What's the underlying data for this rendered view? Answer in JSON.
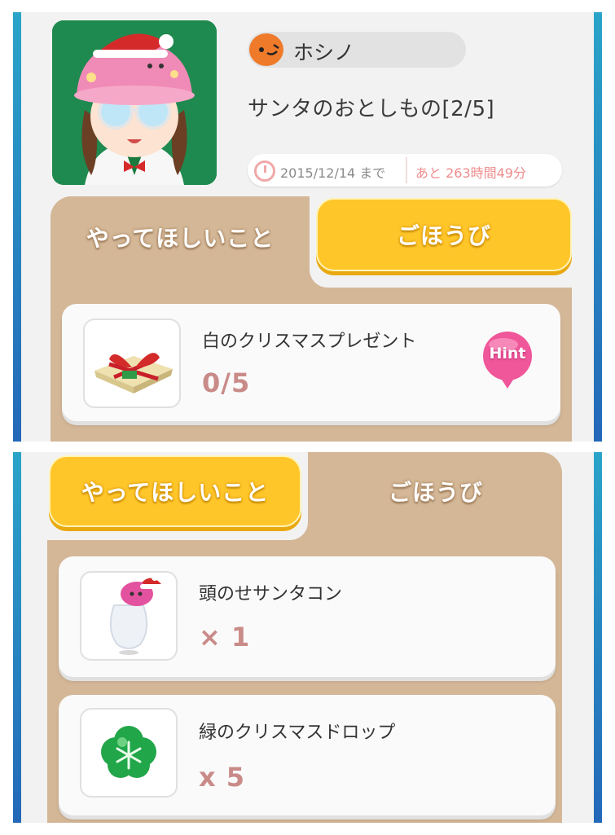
{
  "top": {
    "user_name": "ホシノ",
    "quest_title": "サンタのおとしもの[2/5]",
    "deadline_date": "2015/12/14 まで",
    "deadline_remaining": "あと 263時間49分",
    "tabs": [
      {
        "label": "やってほしいこと",
        "active": true
      },
      {
        "label": "ごほうび",
        "active": false
      }
    ],
    "task": {
      "name": "白のクリスマスプレゼント",
      "progress": "0/5",
      "hint_label": "Hint"
    }
  },
  "bottom": {
    "tabs": [
      {
        "label": "やってほしいこと",
        "active": false
      },
      {
        "label": "ごほうび",
        "active": true
      }
    ],
    "rewards": [
      {
        "name": "頭のせサンタコン",
        "count": "× 1",
        "icon": "santa-hat-ghost-icon"
      },
      {
        "name": "緑のクリスマスドロップ",
        "count": "x 5",
        "icon": "green-snowflake-drop-icon"
      }
    ]
  },
  "colors": {
    "tab_yellow": "#ffc62a",
    "frame_tan": "#d3b797",
    "count_pink": "#c98b88",
    "hint_pink": "#f0569a",
    "side_blue": "#2468b8"
  }
}
